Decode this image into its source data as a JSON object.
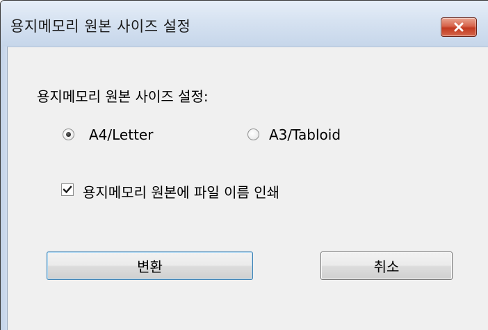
{
  "window": {
    "title": "용지메모리 원본 사이즈 설정"
  },
  "dialog": {
    "size_label": "용지메모리 원본 사이즈 설정:",
    "radio_options": [
      {
        "label": "A4/Letter",
        "selected": true
      },
      {
        "label": "A3/Tabloid",
        "selected": false
      }
    ],
    "print_filename": {
      "label": "용지메모리 원본에 파일 이름 인쇄",
      "checked": true
    },
    "buttons": {
      "convert": "변환",
      "cancel": "취소"
    }
  },
  "icons": {
    "close": "close-icon",
    "radio": "radio-dot-icon",
    "check": "checkmark-icon"
  },
  "colors": {
    "close_button": "#c23a20",
    "title_bar": "#d6e2f1",
    "dialog_background": "#f0f0f0",
    "default_button_border": "#3c7fb1"
  }
}
